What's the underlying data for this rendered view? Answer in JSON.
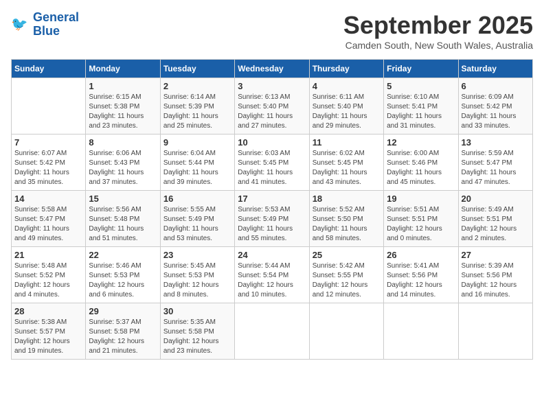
{
  "logo": {
    "line1": "General",
    "line2": "Blue"
  },
  "title": "September 2025",
  "subtitle": "Camden South, New South Wales, Australia",
  "weekdays": [
    "Sunday",
    "Monday",
    "Tuesday",
    "Wednesday",
    "Thursday",
    "Friday",
    "Saturday"
  ],
  "weeks": [
    [
      {
        "day": "",
        "info": ""
      },
      {
        "day": "1",
        "info": "Sunrise: 6:15 AM\nSunset: 5:38 PM\nDaylight: 11 hours\nand 23 minutes."
      },
      {
        "day": "2",
        "info": "Sunrise: 6:14 AM\nSunset: 5:39 PM\nDaylight: 11 hours\nand 25 minutes."
      },
      {
        "day": "3",
        "info": "Sunrise: 6:13 AM\nSunset: 5:40 PM\nDaylight: 11 hours\nand 27 minutes."
      },
      {
        "day": "4",
        "info": "Sunrise: 6:11 AM\nSunset: 5:40 PM\nDaylight: 11 hours\nand 29 minutes."
      },
      {
        "day": "5",
        "info": "Sunrise: 6:10 AM\nSunset: 5:41 PM\nDaylight: 11 hours\nand 31 minutes."
      },
      {
        "day": "6",
        "info": "Sunrise: 6:09 AM\nSunset: 5:42 PM\nDaylight: 11 hours\nand 33 minutes."
      }
    ],
    [
      {
        "day": "7",
        "info": "Sunrise: 6:07 AM\nSunset: 5:42 PM\nDaylight: 11 hours\nand 35 minutes."
      },
      {
        "day": "8",
        "info": "Sunrise: 6:06 AM\nSunset: 5:43 PM\nDaylight: 11 hours\nand 37 minutes."
      },
      {
        "day": "9",
        "info": "Sunrise: 6:04 AM\nSunset: 5:44 PM\nDaylight: 11 hours\nand 39 minutes."
      },
      {
        "day": "10",
        "info": "Sunrise: 6:03 AM\nSunset: 5:45 PM\nDaylight: 11 hours\nand 41 minutes."
      },
      {
        "day": "11",
        "info": "Sunrise: 6:02 AM\nSunset: 5:45 PM\nDaylight: 11 hours\nand 43 minutes."
      },
      {
        "day": "12",
        "info": "Sunrise: 6:00 AM\nSunset: 5:46 PM\nDaylight: 11 hours\nand 45 minutes."
      },
      {
        "day": "13",
        "info": "Sunrise: 5:59 AM\nSunset: 5:47 PM\nDaylight: 11 hours\nand 47 minutes."
      }
    ],
    [
      {
        "day": "14",
        "info": "Sunrise: 5:58 AM\nSunset: 5:47 PM\nDaylight: 11 hours\nand 49 minutes."
      },
      {
        "day": "15",
        "info": "Sunrise: 5:56 AM\nSunset: 5:48 PM\nDaylight: 11 hours\nand 51 minutes."
      },
      {
        "day": "16",
        "info": "Sunrise: 5:55 AM\nSunset: 5:49 PM\nDaylight: 11 hours\nand 53 minutes."
      },
      {
        "day": "17",
        "info": "Sunrise: 5:53 AM\nSunset: 5:49 PM\nDaylight: 11 hours\nand 55 minutes."
      },
      {
        "day": "18",
        "info": "Sunrise: 5:52 AM\nSunset: 5:50 PM\nDaylight: 11 hours\nand 58 minutes."
      },
      {
        "day": "19",
        "info": "Sunrise: 5:51 AM\nSunset: 5:51 PM\nDaylight: 12 hours\nand 0 minutes."
      },
      {
        "day": "20",
        "info": "Sunrise: 5:49 AM\nSunset: 5:51 PM\nDaylight: 12 hours\nand 2 minutes."
      }
    ],
    [
      {
        "day": "21",
        "info": "Sunrise: 5:48 AM\nSunset: 5:52 PM\nDaylight: 12 hours\nand 4 minutes."
      },
      {
        "day": "22",
        "info": "Sunrise: 5:46 AM\nSunset: 5:53 PM\nDaylight: 12 hours\nand 6 minutes."
      },
      {
        "day": "23",
        "info": "Sunrise: 5:45 AM\nSunset: 5:53 PM\nDaylight: 12 hours\nand 8 minutes."
      },
      {
        "day": "24",
        "info": "Sunrise: 5:44 AM\nSunset: 5:54 PM\nDaylight: 12 hours\nand 10 minutes."
      },
      {
        "day": "25",
        "info": "Sunrise: 5:42 AM\nSunset: 5:55 PM\nDaylight: 12 hours\nand 12 minutes."
      },
      {
        "day": "26",
        "info": "Sunrise: 5:41 AM\nSunset: 5:56 PM\nDaylight: 12 hours\nand 14 minutes."
      },
      {
        "day": "27",
        "info": "Sunrise: 5:39 AM\nSunset: 5:56 PM\nDaylight: 12 hours\nand 16 minutes."
      }
    ],
    [
      {
        "day": "28",
        "info": "Sunrise: 5:38 AM\nSunset: 5:57 PM\nDaylight: 12 hours\nand 19 minutes."
      },
      {
        "day": "29",
        "info": "Sunrise: 5:37 AM\nSunset: 5:58 PM\nDaylight: 12 hours\nand 21 minutes."
      },
      {
        "day": "30",
        "info": "Sunrise: 5:35 AM\nSunset: 5:58 PM\nDaylight: 12 hours\nand 23 minutes."
      },
      {
        "day": "",
        "info": ""
      },
      {
        "day": "",
        "info": ""
      },
      {
        "day": "",
        "info": ""
      },
      {
        "day": "",
        "info": ""
      }
    ]
  ]
}
